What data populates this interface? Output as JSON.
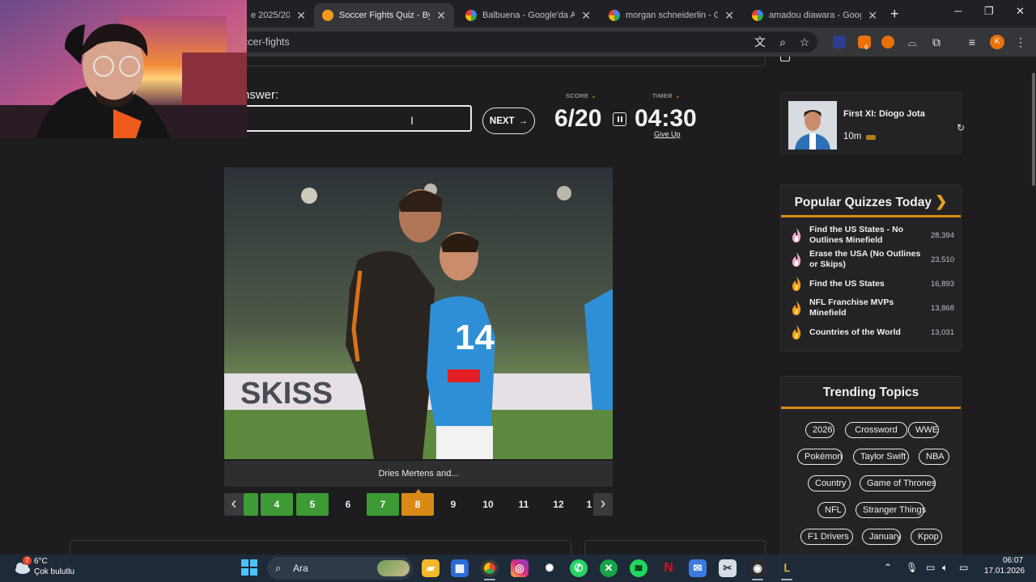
{
  "browser": {
    "tabs": [
      {
        "title": "e 2025/2026",
        "favicon": "generic"
      },
      {
        "title": "Soccer Fights Quiz - By cha",
        "favicon": "quiz",
        "active": true
      },
      {
        "title": "Balbuena - Google'da Ara",
        "favicon": "google"
      },
      {
        "title": "morgan schneiderlin - Goo",
        "favicon": "google"
      },
      {
        "title": "amadou diawara - Google'",
        "favicon": "google"
      }
    ],
    "url": "ccer-fights",
    "extension_badge_count": "6",
    "profile_initial": "K"
  },
  "quiz": {
    "answer_label": "nswer:",
    "answer_value": "",
    "next_label": "NEXT",
    "score_label": "SCORE",
    "score_value": "6/20",
    "timer_label": "TIMER",
    "timer_value": "04:30",
    "give_up_label": "Give Up",
    "caption": "Dries Mertens and...",
    "pages": [
      {
        "label": "",
        "status": "correct"
      },
      {
        "label": "4",
        "status": "correct"
      },
      {
        "label": "5",
        "status": "correct"
      },
      {
        "label": "6",
        "status": "none"
      },
      {
        "label": "7",
        "status": "correct"
      },
      {
        "label": "8",
        "status": "current"
      },
      {
        "label": "9",
        "status": "none"
      },
      {
        "label": "10",
        "status": "none"
      },
      {
        "label": "11",
        "status": "none"
      },
      {
        "label": "12",
        "status": "none"
      },
      {
        "label": "1",
        "status": "none"
      }
    ]
  },
  "sidebar": {
    "recommended": {
      "title": "First XI: Diogo Jota",
      "time": "10m"
    },
    "popular_title": "Popular Quizzes Today",
    "popular": [
      {
        "name": "Find the US States - No Outlines Minefield",
        "count": "28,394",
        "flame": "pink"
      },
      {
        "name": "Erase the USA (No Outlines or Skips)",
        "count": "23,510",
        "flame": "pink"
      },
      {
        "name": "Find the US States",
        "count": "16,893",
        "flame": "orange"
      },
      {
        "name": "NFL Franchise MVPs Minefield",
        "count": "13,868",
        "flame": "orange"
      },
      {
        "name": "Countries of the World",
        "count": "13,031",
        "flame": "orange"
      }
    ],
    "trending_title": "Trending Topics",
    "trending": [
      "2026",
      "Crossword",
      "WWE",
      "Pokémon",
      "Taylor Swift",
      "NBA",
      "Country",
      "Game of Thrones",
      "NFL",
      "Stranger Things",
      "F1 Drivers",
      "January",
      "Kpop"
    ]
  },
  "taskbar": {
    "weather_badge": "7",
    "weather_temp": "6°C",
    "weather_desc": "Çok bulutlu",
    "search_label": "Ara",
    "time": "06:07",
    "date": "17.01.2026"
  },
  "colors": {
    "accent": "#d98a15",
    "correct": "#3d9a35",
    "background": "#1d1d1f"
  }
}
